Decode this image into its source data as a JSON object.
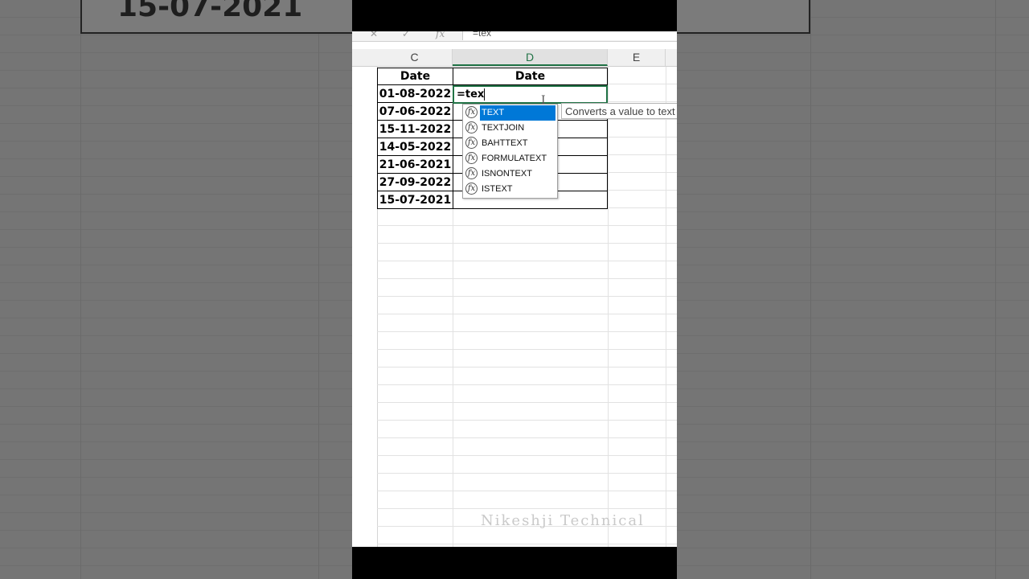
{
  "background": {
    "banner_date": "15-07-2021"
  },
  "formula_bar": {
    "cancel_icon": "close-icon",
    "enter_icon": "check-icon",
    "fx_label": "fx",
    "content": "=tex"
  },
  "columns": [
    "C",
    "D",
    "E"
  ],
  "table": {
    "headers": [
      "Date",
      "Date"
    ],
    "dates": [
      "01-08-2022",
      "07-06-2022",
      "15-11-2022",
      "14-05-2022",
      "21-06-2021",
      "27-09-2022",
      "15-07-2021"
    ]
  },
  "active_cell": {
    "text": "=tex"
  },
  "autocomplete": {
    "items": [
      "TEXT",
      "TEXTJOIN",
      "BAHTTEXT",
      "FORMULATEXT",
      "ISNONTEXT",
      "ISTEXT"
    ],
    "selected_index": 0,
    "icon_label": "fx",
    "tooltip": "Converts a value to text"
  },
  "watermark": "Nikeshji Technical",
  "colors": {
    "accent_green": "#217346",
    "selection_blue": "#0078d7"
  }
}
